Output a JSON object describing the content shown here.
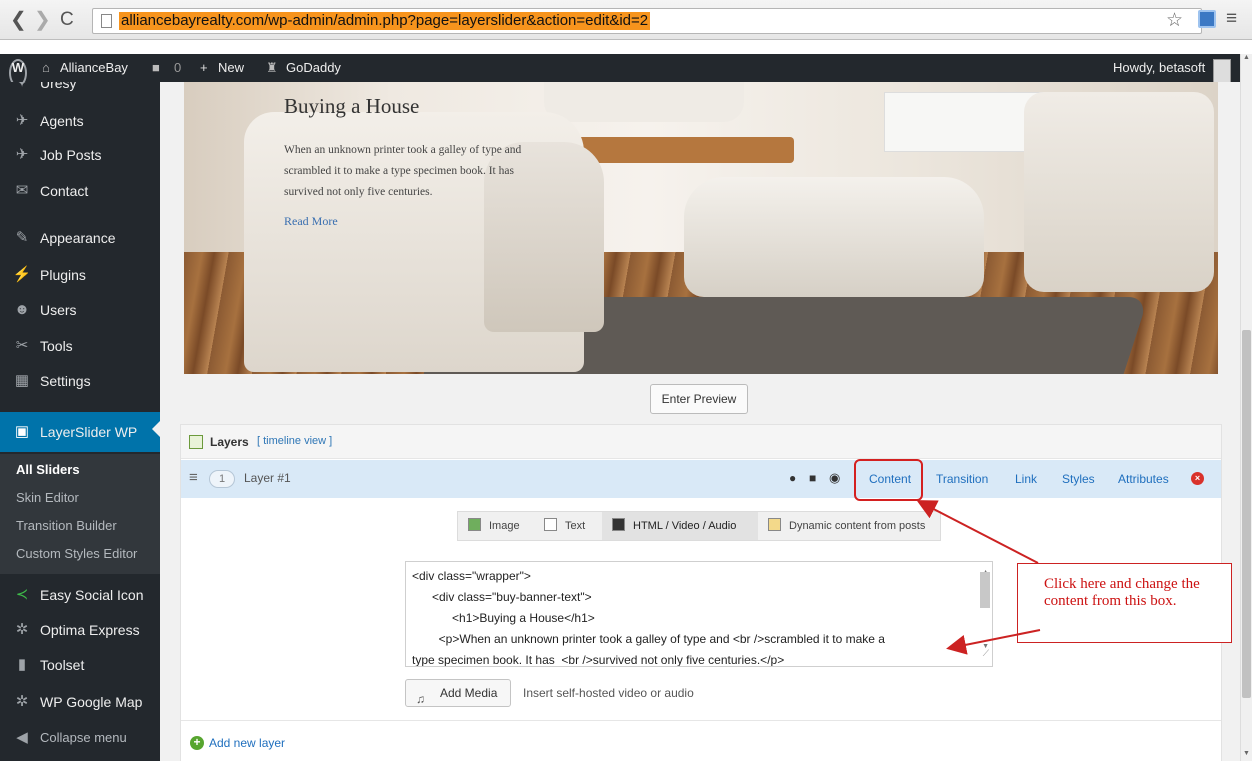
{
  "browser": {
    "url": "alliancebayrealty.com/wp-admin/admin.php?page=layerslider&action=edit&id=2",
    "back": "❮",
    "forward": "❯",
    "reload": "C"
  },
  "admin_bar": {
    "site_name": "AllianceBay",
    "comment_count": "0",
    "new_label": "New",
    "godaddy_label": "GoDaddy",
    "howdy": "Howdy, betasoft"
  },
  "sidebar": {
    "items": [
      {
        "label": "Uresy",
        "icon": "tag-icon"
      },
      {
        "label": "Agents",
        "icon": "pin-icon"
      },
      {
        "label": "Job Posts",
        "icon": "pin-icon"
      },
      {
        "label": "Contact",
        "icon": "mail-icon"
      },
      {
        "label": "Appearance",
        "icon": "brush-icon"
      },
      {
        "label": "Plugins",
        "icon": "plug-icon"
      },
      {
        "label": "Users",
        "icon": "users-icon"
      },
      {
        "label": "Tools",
        "icon": "wrench-icon"
      },
      {
        "label": "Settings",
        "icon": "settings-icon"
      },
      {
        "label": "LayerSlider WP",
        "icon": "layerslider-icon"
      },
      {
        "label": "Easy Social Icon",
        "icon": "share-icon"
      },
      {
        "label": "Optima Express",
        "icon": "gear-icon"
      },
      {
        "label": "Toolset",
        "icon": "toolset-icon"
      },
      {
        "label": "WP Google Map",
        "icon": "gear-icon"
      },
      {
        "label": "Collapse menu",
        "icon": "collapse-icon"
      }
    ],
    "submenu": [
      "All Sliders",
      "Skin Editor",
      "Transition Builder",
      "Custom Styles Editor"
    ]
  },
  "slide": {
    "title": "Buying a House",
    "text_line1": "When an unknown printer took a galley of type and",
    "text_line2": "scrambled it to make a type specimen book. It has",
    "text_line3": "survived not only five centuries.",
    "read_more": "Read More"
  },
  "preview_button": "Enter Preview",
  "layers": {
    "title": "Layers",
    "timeline_link": "[ timeline view ]",
    "layer_number": "1",
    "layer_name": "Layer #1",
    "tabs": {
      "content": "Content",
      "transition": "Transition",
      "link": "Link",
      "styles": "Styles",
      "attributes": "Attributes"
    },
    "type_tabs": {
      "image": "Image",
      "text": "Text",
      "html": "HTML / Video / Audio",
      "dynamic": "Dynamic content from posts"
    },
    "code_lines": [
      "<div class=\"wrapper\">",
      "      <div class=\"buy-banner-text\">",
      "            <h1>Buying a House</h1>",
      "        <p>When an unknown printer took a galley of type and <br />scrambled it to make a",
      "type specimen book. It has  <br />survived not only five centuries.</p>"
    ],
    "add_media": "Add Media",
    "media_hint": "Insert self-hosted video or audio",
    "add_new_layer": "Add new layer"
  },
  "annotation": {
    "callout_text": "Click here and change the content from this box.",
    "color": "#cc2222"
  },
  "colors": {
    "admin_dark": "#23282d",
    "active_blue": "#0073aa",
    "link_blue": "#1f6fbe",
    "url_highlight": "#f7941d"
  }
}
